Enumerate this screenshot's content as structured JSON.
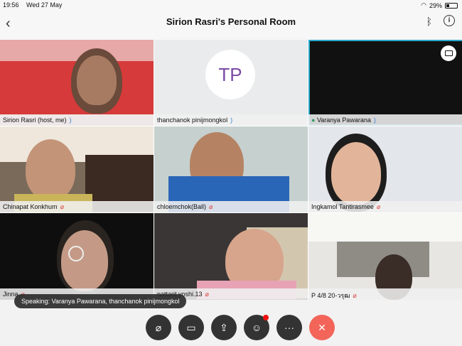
{
  "status": {
    "time": "19:56",
    "date": "Wed 27 May",
    "battery": "29%"
  },
  "header": {
    "title": "Sirion Rasri's Personal Room"
  },
  "participants": [
    {
      "name": "Sirion Rasri (host, me)",
      "mic": "on"
    },
    {
      "name": "thanchanok pinijmongkol",
      "mic": "on",
      "initials": "TP"
    },
    {
      "name": "Varanya Pawarana",
      "mic": "on"
    },
    {
      "name": "Chinapat Konkhum",
      "mic": "off"
    },
    {
      "name": "chloemchok(Ball)",
      "mic": "off"
    },
    {
      "name": "Ingkamol Tantirasmee",
      "mic": "off"
    },
    {
      "name": "Jinna",
      "mic": "off"
    },
    {
      "name": "nattarit yoshi.13",
      "mic": "off"
    },
    {
      "name": "P 4/8 20-วรุฒ",
      "mic": "off"
    }
  ],
  "speaking_banner": "Speaking: Varanya Pawarana, thanchanok pinijmongkol",
  "colors": {
    "accent": "#2aa7c9",
    "end_call": "#f36559",
    "mic_on": "#2d7fd3",
    "mic_off": "#d63b3b"
  }
}
